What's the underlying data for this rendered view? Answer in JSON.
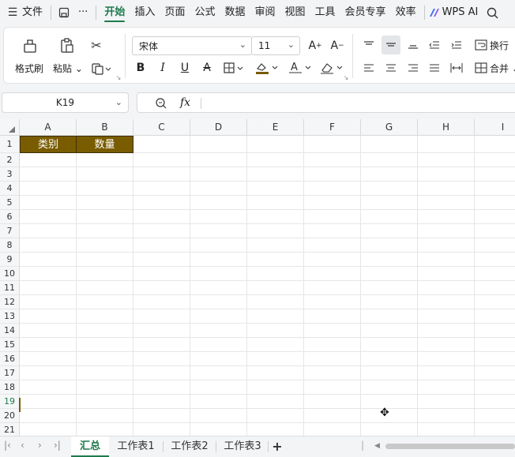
{
  "menubar": {
    "file": "文件",
    "more": "···",
    "tabs": [
      "开始",
      "插入",
      "页面",
      "公式",
      "数据",
      "审阅",
      "视图",
      "工具",
      "会员专享",
      "效率"
    ],
    "active_tab": "开始",
    "wps_ai": "WPS AI"
  },
  "ribbon": {
    "format_painter": "格式刷",
    "paste": "粘贴",
    "font_name": "宋体",
    "font_size": "11",
    "bold": "B",
    "italic": "I",
    "underline": "U",
    "wrap": "换行",
    "merge": "合并"
  },
  "formula_bar": {
    "name_box": "K19",
    "fx": "fx"
  },
  "grid": {
    "columns": [
      "A",
      "B",
      "C",
      "D",
      "E",
      "F",
      "G",
      "H",
      "I"
    ],
    "rows": [
      "1",
      "2",
      "3",
      "4",
      "5",
      "6",
      "7",
      "8",
      "9",
      "10",
      "11",
      "12",
      "13",
      "14",
      "15",
      "16",
      "17",
      "18",
      "19",
      "20",
      "21"
    ],
    "selected_row": "19",
    "cells": {
      "A1": "类别",
      "B1": "数量"
    },
    "header_fill": "#7a5c00"
  },
  "sheets": {
    "tabs": [
      "汇总",
      "工作表1",
      "工作表2",
      "工作表3"
    ],
    "active": "汇总",
    "add": "+"
  }
}
